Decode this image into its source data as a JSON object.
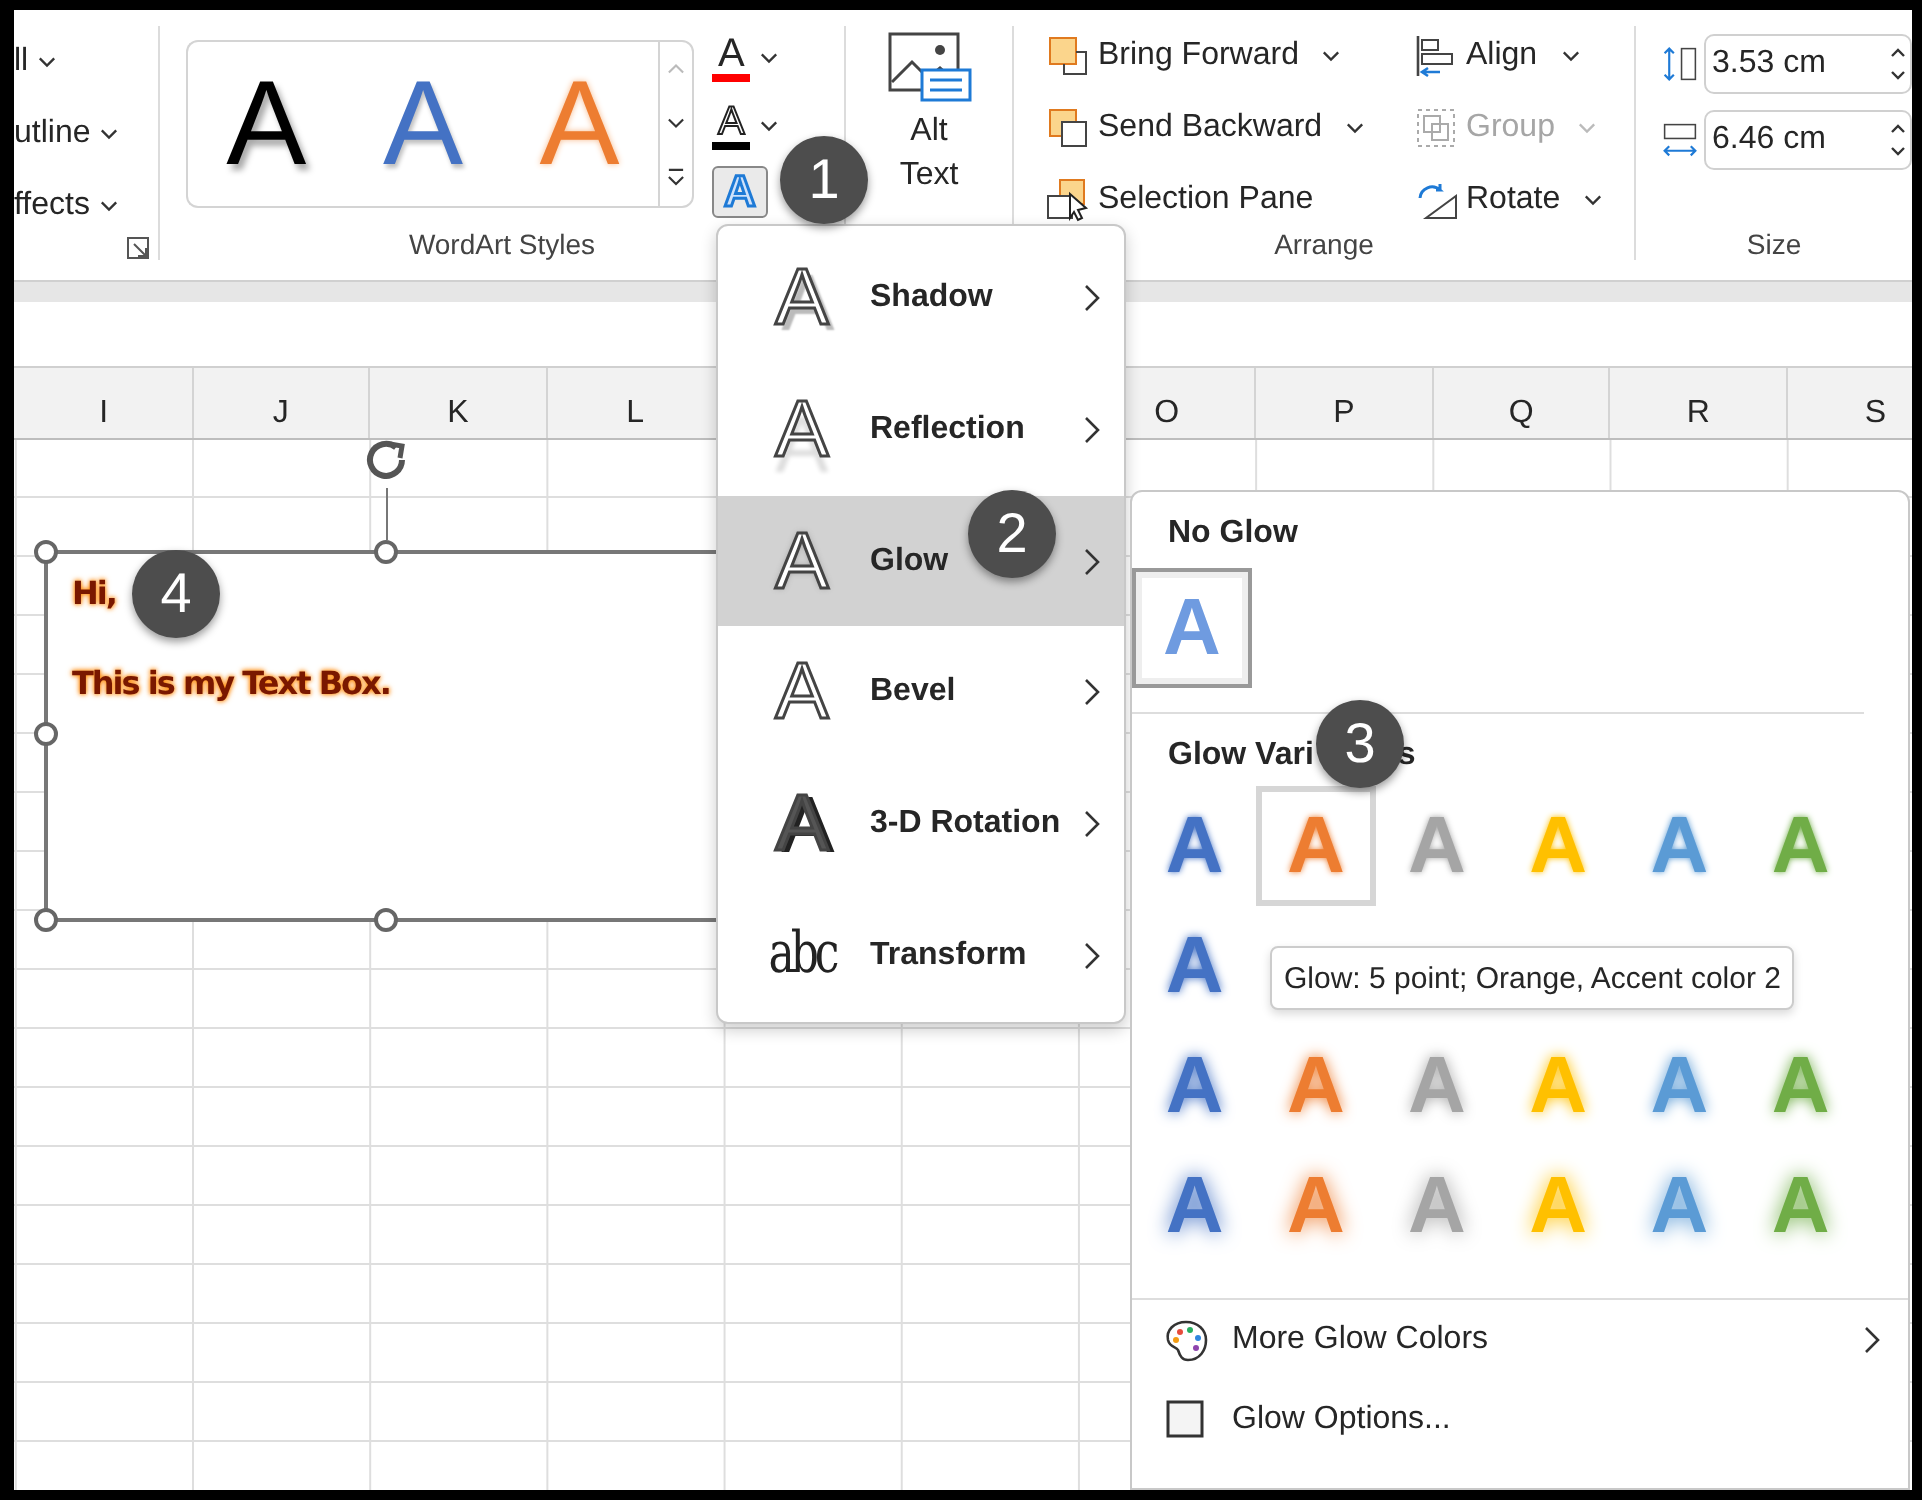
{
  "ribbon": {
    "shape_format_partial": [
      {
        "label": "ll",
        "dropdown": true
      },
      {
        "label": "utline",
        "dropdown": true
      },
      {
        "label": "ffects",
        "dropdown": true
      }
    ],
    "wordart_styles": {
      "label": "WordArt Styles",
      "gallery": [
        {
          "glyph": "A",
          "kind": "shadowed",
          "color": "#000000"
        },
        {
          "glyph": "A",
          "kind": "plain",
          "color": "#4472c4"
        },
        {
          "glyph": "A",
          "kind": "outlined",
          "color": "#ed7d31"
        }
      ],
      "text_fill": {
        "glyph": "A",
        "color": "#ff0000"
      },
      "text_outline": {
        "glyph": "A",
        "color": "#000000"
      },
      "text_effects": {
        "glyph": "A",
        "selected": true
      }
    },
    "alt_text": {
      "label": "Alt Text"
    },
    "arrange": {
      "label": "Arrange",
      "left": [
        {
          "label": "Bring Forward",
          "kind": "bring_forward",
          "dropdown": true,
          "disabled": false
        },
        {
          "label": "Send Backward",
          "kind": "send_backward",
          "dropdown": true,
          "disabled": false
        },
        {
          "label": "Selection Pane",
          "kind": "selection_pane",
          "dropdown": false,
          "disabled": false
        }
      ],
      "right": [
        {
          "label": "Align",
          "kind": "align",
          "dropdown": true,
          "disabled": false
        },
        {
          "label": "Group",
          "kind": "group",
          "dropdown": true,
          "disabled": true
        },
        {
          "label": "Rotate",
          "kind": "rotate",
          "dropdown": true,
          "disabled": false
        }
      ]
    },
    "size": {
      "label": "Size",
      "fields": [
        {
          "kind": "height",
          "value": "3.53 cm"
        },
        {
          "kind": "width",
          "value": "6.46 cm"
        }
      ]
    }
  },
  "sheet": {
    "columns_left": [
      "I",
      "J",
      "K",
      "L"
    ],
    "columns_right": [
      "O",
      "P",
      "Q",
      "R",
      "S"
    ],
    "text_box": {
      "lines": [
        "Hi,",
        "This is my Text Box."
      ]
    }
  },
  "effects_menu": [
    {
      "label": "Shadow",
      "kind": "shadow",
      "glyph": "A",
      "selected": false
    },
    {
      "label": "Reflection",
      "kind": "reflection",
      "glyph": "A",
      "selected": false
    },
    {
      "label": "Glow",
      "kind": "glow",
      "glyph": "A",
      "selected": true
    },
    {
      "label": "Bevel",
      "kind": "bevel",
      "glyph": "A",
      "selected": false
    },
    {
      "label": "3-D Rotation",
      "kind": "rotation",
      "glyph": "A",
      "selected": false
    },
    {
      "label": "Transform",
      "kind": "transform",
      "glyph": "abc",
      "selected": false
    }
  ],
  "glow_menu": {
    "no_glow": {
      "title": "No Glow",
      "item": {
        "glyph": "A",
        "selected": true
      }
    },
    "variations": {
      "title": "Glow Vari",
      "title_tail": "s",
      "rows": [
        [
          {
            "glyph": "A",
            "color": "#4472c4",
            "selected": false
          },
          {
            "glyph": "A",
            "color": "#ed7d31",
            "selected": true
          },
          {
            "glyph": "A",
            "color": "#a5a5a5",
            "selected": false
          },
          {
            "glyph": "A",
            "color": "#ffc000",
            "selected": false
          },
          {
            "glyph": "A",
            "color": "#5b9bd5",
            "selected": false
          },
          {
            "glyph": "A",
            "color": "#70ad47",
            "selected": false
          }
        ],
        [
          {
            "glyph": "A",
            "color": "#4472c4",
            "selected": false
          }
        ],
        [
          {
            "glyph": "A",
            "color": "#4472c4",
            "selected": false
          },
          {
            "glyph": "A",
            "color": "#ed7d31",
            "selected": false
          },
          {
            "glyph": "A",
            "color": "#a5a5a5",
            "selected": false
          },
          {
            "glyph": "A",
            "color": "#ffc000",
            "selected": false
          },
          {
            "glyph": "A",
            "color": "#5b9bd5",
            "selected": false
          },
          {
            "glyph": "A",
            "color": "#70ad47",
            "selected": false
          }
        ],
        [
          {
            "glyph": "A",
            "color": "#4472c4",
            "selected": false
          },
          {
            "glyph": "A",
            "color": "#ed7d31",
            "selected": false
          },
          {
            "glyph": "A",
            "color": "#a5a5a5",
            "selected": false
          },
          {
            "glyph": "A",
            "color": "#ffc000",
            "selected": false
          },
          {
            "glyph": "A",
            "color": "#5b9bd5",
            "selected": false
          },
          {
            "glyph": "A",
            "color": "#70ad47",
            "selected": false
          }
        ]
      ]
    },
    "tooltip": "Glow: 5 point; Orange, Accent color 2",
    "footer": [
      {
        "label": "More Glow Colors",
        "kind": "colors",
        "submenu": true
      },
      {
        "label": "Glow Options...",
        "kind": "options",
        "submenu": false
      }
    ]
  },
  "callouts": [
    "1",
    "2",
    "3",
    "4"
  ]
}
